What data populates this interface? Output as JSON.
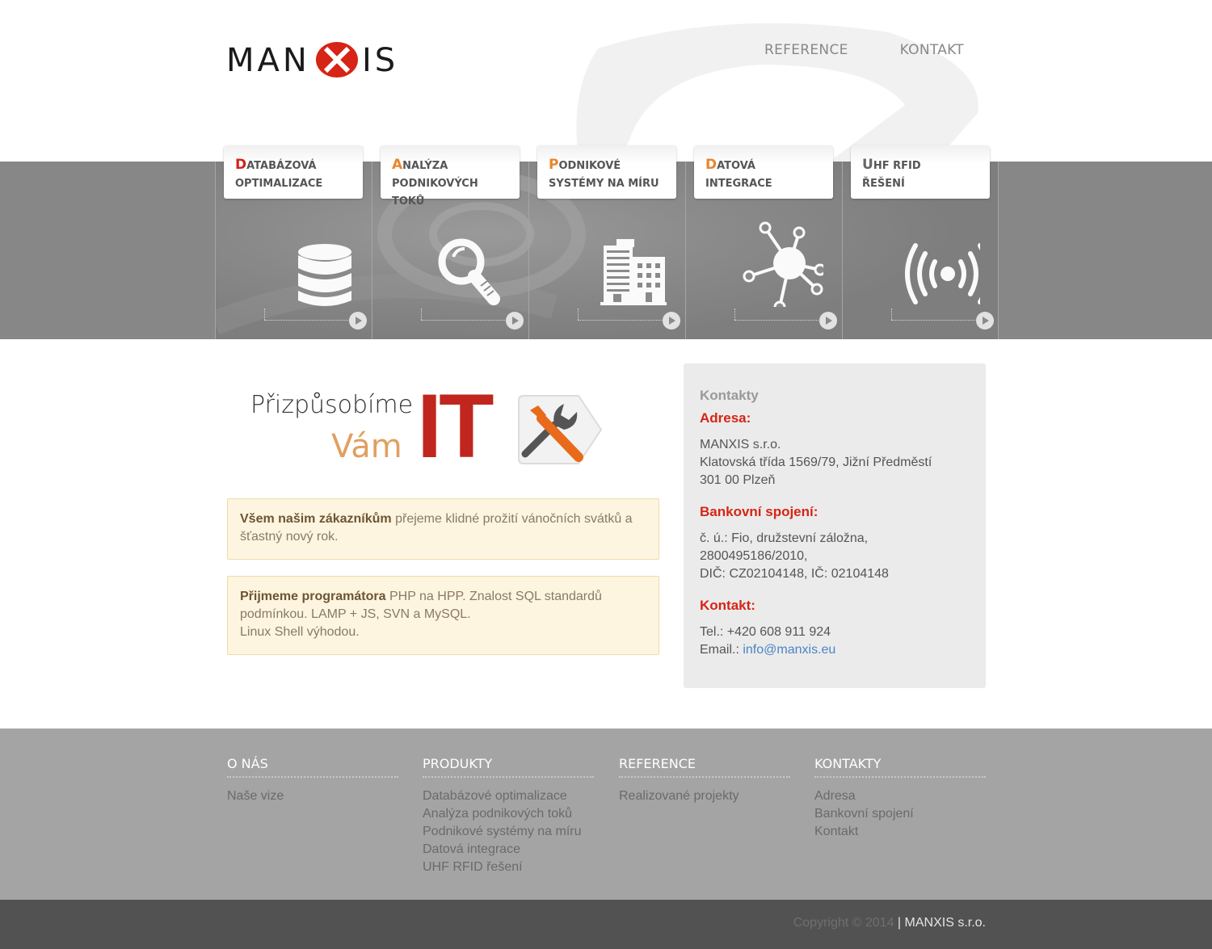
{
  "brand": {
    "logo_text": "MANXIS",
    "accent_color": "#d62416"
  },
  "topnav": [
    {
      "label": "REFERENCE"
    },
    {
      "label": "KONTAKT"
    }
  ],
  "services": [
    {
      "first": "D",
      "rest": "atabázová",
      "line2": "optimalizace",
      "icon": "database-icon"
    },
    {
      "first": "A",
      "rest": "nalýza",
      "line2": "podnikových toků",
      "icon": "magnifier-icon"
    },
    {
      "first": "P",
      "rest": "odnikové",
      "line2": "systémy na míru",
      "icon": "buildings-icon"
    },
    {
      "first": "D",
      "rest": "atová",
      "line2": "integrace",
      "icon": "network-icon"
    },
    {
      "first": "U",
      "rest": "HF RFID",
      "line2": "řešení",
      "icon": "wireless-icon"
    }
  ],
  "hero": {
    "line1": "Přizpůsobíme",
    "line2": "Vám",
    "highlight": "IT"
  },
  "notices": [
    {
      "bold": "Všem našim zákazníkům",
      "text": " přejeme klidné prožití vánočních svátků a šťastný nový rok."
    },
    {
      "bold": "Přijmeme programátora",
      "text": " PHP na HPP. Znalost SQL standardů podmínkou. LAMP + JS, SVN a MySQL.",
      "text2": "Linux Shell výhodou."
    }
  ],
  "contacts": {
    "title": "Kontakty",
    "address_heading": "Adresa:",
    "address_lines": [
      "MANXIS s.r.o.",
      "Klatovská třída 1569/79, Jižní Předměstí",
      "301 00 Plzeň"
    ],
    "bank_heading": "Bankovní spojení:",
    "bank_lines": [
      "č. ú.: Fio, družstevní záložna,",
      "2800495186/2010,",
      "DIČ: CZ02104148, IČ: 02104148"
    ],
    "contact_heading": "Kontakt:",
    "phone": "Tel.: +420 608 911 924",
    "email_label": "Email.: ",
    "email": "info@manxis.eu"
  },
  "footer": {
    "columns": [
      {
        "title": "O NÁS",
        "items": [
          "Naše vize"
        ]
      },
      {
        "title": "PRODUKTY",
        "items": [
          "Databázové optimalizace",
          "Analýza podnikových toků",
          "Podnikové systémy na míru",
          "Datová integrace",
          "UHF RFID řešení"
        ]
      },
      {
        "title": "REFERENCE",
        "items": [
          "Realizované projekty"
        ]
      },
      {
        "title": "KONTAKTY",
        "items": [
          "Adresa",
          "Bankovní spojení",
          "Kontakt"
        ]
      }
    ],
    "copyright": "Copyright © 2014",
    "company": "| MANXIS s.r.o."
  }
}
